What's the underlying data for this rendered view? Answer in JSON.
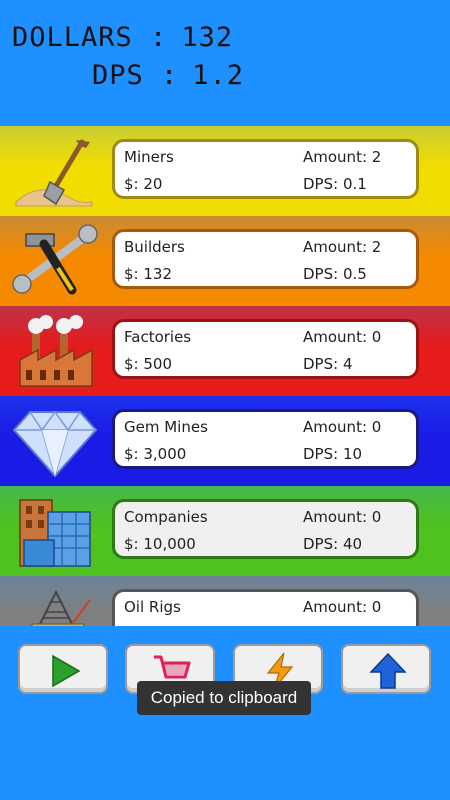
{
  "header": {
    "dollars_label": "DOLLARS :",
    "dollars_value": "132",
    "dps_label": "DPS :",
    "dps_value": "1.2"
  },
  "items": [
    {
      "name": "Miners",
      "amount": "Amount: 2",
      "price": "$: 20",
      "dps": "DPS: 0.1",
      "icon": "shovel-icon",
      "band_color": "#f2dd00",
      "border_color": "#a08a16"
    },
    {
      "name": "Builders",
      "amount": "Amount: 2",
      "price": "$: 132",
      "dps": "DPS: 0.5",
      "icon": "tools-icon",
      "band_color": "#f58a00",
      "border_color": "#a55a10"
    },
    {
      "name": "Factories",
      "amount": "Amount: 0",
      "price": "$: 500",
      "dps": "DPS: 4",
      "icon": "factory-icon",
      "band_color": "#e61b1b",
      "border_color": "#9a1414"
    },
    {
      "name": "Gem Mines",
      "amount": "Amount: 0",
      "price": "$: 3,000",
      "dps": "DPS: 10",
      "icon": "diamond-icon",
      "band_color": "#1b1be6",
      "border_color": "#1a1a80"
    },
    {
      "name": "Companies",
      "amount": "Amount: 0",
      "price": "$: 10,000",
      "dps": "DPS: 40",
      "icon": "building-icon",
      "band_color": "#4fc21f",
      "border_color": "#2f7a16"
    },
    {
      "name": "Oil Rigs",
      "amount": "Amount: 0",
      "price": "",
      "dps": "",
      "icon": "oil-rig-icon",
      "band_color": "#808080",
      "border_color": "#555555"
    }
  ],
  "buttons": [
    {
      "name": "play-button",
      "icon": "play-icon"
    },
    {
      "name": "shop-button",
      "icon": "cart-icon"
    },
    {
      "name": "boost-button",
      "icon": "lightning-icon"
    },
    {
      "name": "upgrade-button",
      "icon": "arrow-up-icon"
    }
  ],
  "toast": "Copied to clipboard"
}
